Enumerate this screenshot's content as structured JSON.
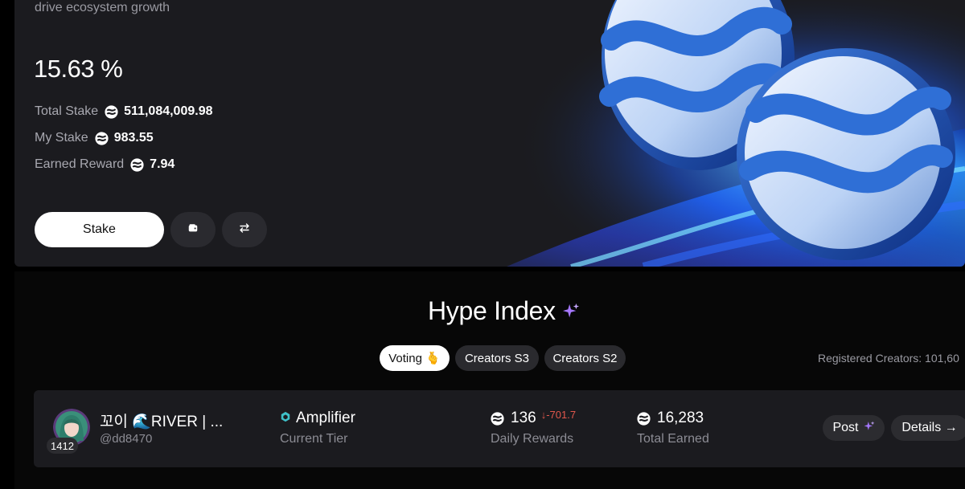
{
  "stake_card": {
    "subtitle": "drive ecosystem growth",
    "apy": "15.63 %",
    "stats": [
      {
        "label": "Total Stake",
        "value": "511,084,009.98"
      },
      {
        "label": "My Stake",
        "value": "983.55"
      },
      {
        "label": "Earned Reward",
        "value": "7.94"
      }
    ],
    "stake_label": "Stake"
  },
  "hype": {
    "title": "Hype Index",
    "tabs": [
      {
        "label": "Voting 🫰",
        "active": true
      },
      {
        "label": "Creators S3",
        "active": false
      },
      {
        "label": "Creators S2",
        "active": false
      }
    ],
    "registered": "Registered Creators: 101,60",
    "row": {
      "rank": "1412",
      "name": "꼬이 🌊RIVER | ...",
      "handle": "@dd8470",
      "tier": "Amplifier",
      "tier_label": "Current Tier",
      "daily_value": "136",
      "daily_delta": "↓-701.7",
      "daily_label": "Daily Rewards",
      "total_value": "16,283",
      "total_label": "Total Earned",
      "post_label": "Post",
      "details_label": "Details →"
    }
  },
  "colors": {
    "accent": "#3a8dff",
    "sparkle": "#9b6bff",
    "negative": "#e2574c",
    "tier": "#3fc1c9"
  },
  "icons": [
    "river-coin-icon",
    "wallet-icon",
    "swap-icon",
    "sparkle-icon",
    "tier-hex-icon"
  ]
}
